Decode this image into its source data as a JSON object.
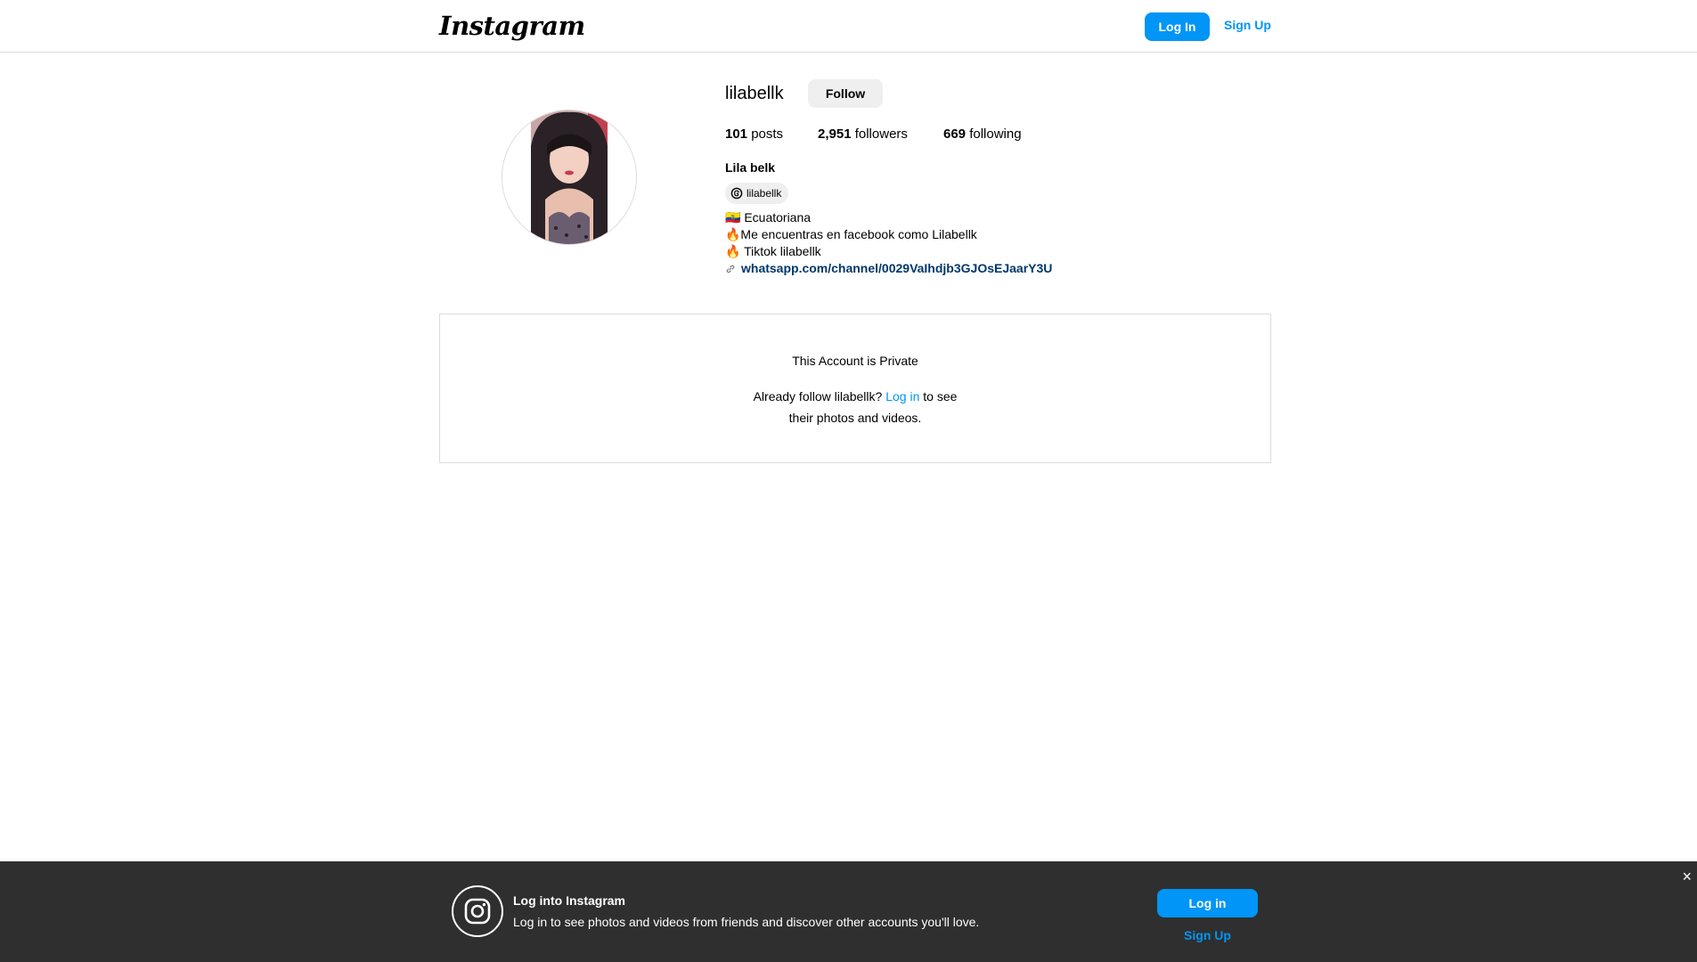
{
  "header": {
    "logo_text": "Instagram",
    "login_label": "Log In",
    "signup_label": "Sign Up"
  },
  "profile": {
    "username": "lilabellk",
    "follow_label": "Follow",
    "stats": {
      "posts_count": "101",
      "posts_label": "posts",
      "followers_count": "2,951",
      "followers_label": "followers",
      "following_count": "669",
      "following_label": "following"
    },
    "full_name": "Lila belk",
    "threads_handle": "lilabellk",
    "bio_lines": [
      "🇪🇨 Ecuatoriana",
      "🔥Me encuentras en facebook como Lilabellk",
      "🔥 Tiktok lilabellk"
    ],
    "link": "whatsapp.com/channel/0029VaIhdjb3GJOsEJaarY3U"
  },
  "private_notice": {
    "title": "This Account is Private",
    "text_before": "Already follow lilabellk?",
    "login_link": "Log in",
    "text_after_1": "to see",
    "text_after_2": "their photos and videos."
  },
  "banner": {
    "title": "Log into Instagram",
    "subtitle": "Log in to see photos and videos from friends and discover other accounts you'll love.",
    "login_label": "Log in",
    "signup_label": "Sign Up",
    "close_symbol": "×"
  },
  "colors": {
    "accent": "#0095f6",
    "link_dark": "#00376b",
    "banner_bg": "#2f2f2f",
    "border": "#dbdbdb"
  }
}
